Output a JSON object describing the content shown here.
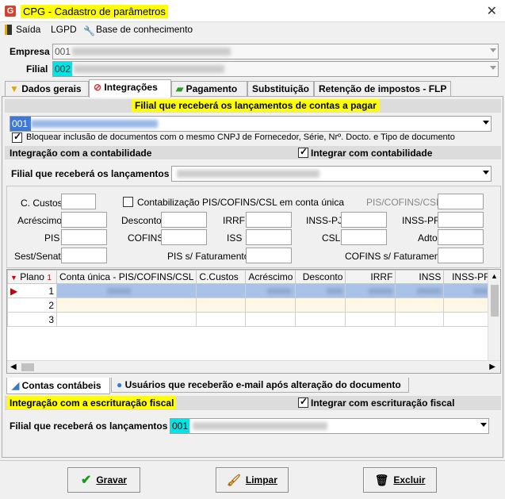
{
  "window": {
    "title": "CPG - Cadastro de parâmetros",
    "close": "✕"
  },
  "menu": {
    "saida": "Saída",
    "lgpd": "LGPD",
    "base": "Base de conhecimento"
  },
  "empresa": {
    "label": "Empresa",
    "code": "001"
  },
  "filial": {
    "label": "Filial",
    "code": "002"
  },
  "tabs": [
    {
      "label": "Dados gerais"
    },
    {
      "label": "Integrações"
    },
    {
      "label": "Pagamento"
    },
    {
      "label": "Substituição"
    },
    {
      "label": "Retenção de impostos - FLP"
    }
  ],
  "contas_pagar": {
    "header": "Filial que receberá os lançamentos de contas a pagar",
    "code": "001",
    "bloquear_label": "Bloquear inclusão de documentos com o mesmo CNPJ de Fornecedor, Série, Nrº. Docto. e Tipo de documento"
  },
  "contabilidade": {
    "header": "Integração com a contabilidade",
    "integrar_label": "Integrar com contabilidade",
    "filial_label": "Filial que receberá os lançamentos"
  },
  "fields": {
    "c_custos": "C. Custos",
    "contab_pis": "Contabilização PIS/COFINS/CSL em conta única",
    "pis_cofins_csl": "PIS/COFINS/CSL",
    "acrescimo": "Acréscimo",
    "desconto": "Desconto",
    "irrf": "IRRF",
    "inss_pj": "INSS-PJ",
    "inss_pf": "INSS-PF",
    "pis": "PIS",
    "cofins": "COFINS",
    "iss": "ISS",
    "csl": "CSL",
    "adto": "Adto",
    "sest_senat": "Sest/Senat",
    "pis_fat": "PIS s/ Faturamento",
    "cofins_fat": "COFINS s/ Faturamento"
  },
  "grid": {
    "headers": [
      "Plano",
      "Conta única - PIS/COFINS/CSL",
      "C.Custos",
      "Acréscimo",
      "Desconto",
      "IRRF",
      "INSS",
      "INSS-PF"
    ],
    "rows": [
      "1",
      "2",
      "3"
    ]
  },
  "subtabs": [
    {
      "label": "Contas contábeis"
    },
    {
      "label": "Usuários que receberão e-mail após alteração do documento"
    }
  ],
  "fiscal": {
    "header": "Integração com a escrituração fiscal",
    "integrar_label": "Integrar com escrituração fiscal",
    "filial_label": "Filial que receberá os lançamentos",
    "code": "001"
  },
  "buttons": {
    "gravar": "Gravar",
    "limpar": "Limpar",
    "excluir": "Excluir"
  },
  "colors": {
    "highlight_yellow": "#ffff00",
    "highlight_cyan": "#00e5e5",
    "selection": "#a9c3e8"
  }
}
